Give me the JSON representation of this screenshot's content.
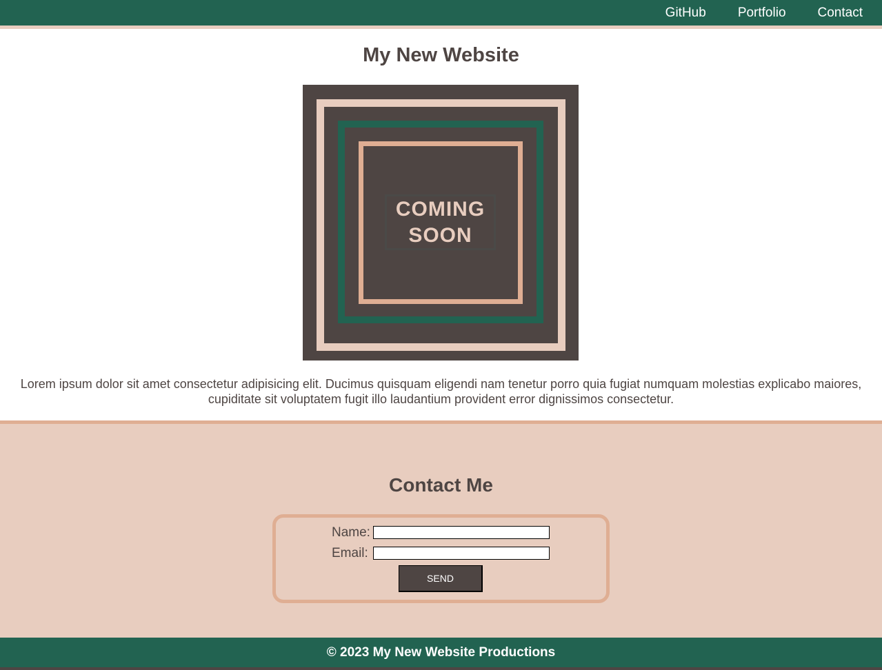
{
  "nav": {
    "links": [
      {
        "label": "GitHub"
      },
      {
        "label": "Portfolio"
      },
      {
        "label": "Contact"
      }
    ]
  },
  "main": {
    "title": "My New Website",
    "hero": {
      "line1": "COMING",
      "line2": "SOON"
    },
    "intro": "Lorem ipsum dolor sit amet consectetur adipisicing elit. Ducimus quisquam eligendi nam tenetur porro quia fugiat numquam molestias explicabo maiores, cupiditate sit voluptatem fugit illo laudantium provident error dignissimos consectetur."
  },
  "contact": {
    "title": "Contact Me",
    "name_label": "Name:",
    "name_value": "",
    "email_label": "Email:",
    "email_value": "",
    "send_label": "SEND"
  },
  "footer": {
    "text": "© 2023 My New Website Productions"
  },
  "colors": {
    "green": "#226351",
    "dark": "#4e4543",
    "peach": "#e8cdbf",
    "tan": "#dfae93"
  }
}
